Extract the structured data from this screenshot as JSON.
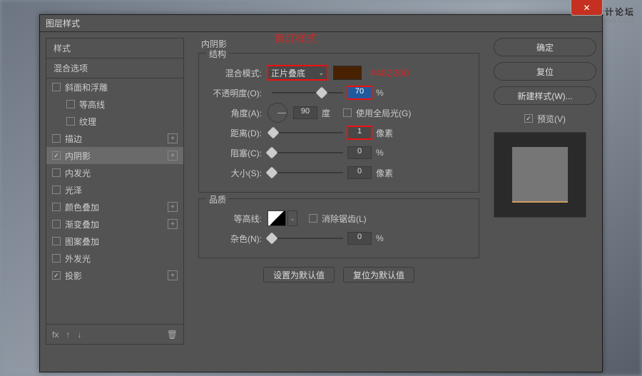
{
  "watermark": {
    "line1": "思缘设计论坛",
    "line2": "WWW.MISSYUAN.COM"
  },
  "close_icon": "✕",
  "dialog_title": "图层样式",
  "anno_title": "黄灯样式",
  "hex_anno": "#482200",
  "left": {
    "header1": "样式",
    "header2": "混合选项",
    "items": [
      {
        "label": "斜面和浮雕",
        "checked": false,
        "plus": false,
        "indent": false
      },
      {
        "label": "等高线",
        "checked": false,
        "plus": false,
        "indent": true
      },
      {
        "label": "纹理",
        "checked": false,
        "plus": false,
        "indent": true
      },
      {
        "label": "描边",
        "checked": false,
        "plus": true,
        "indent": false
      },
      {
        "label": "内阴影",
        "checked": true,
        "plus": true,
        "indent": false,
        "selected": true
      },
      {
        "label": "内发光",
        "checked": false,
        "plus": false,
        "indent": false
      },
      {
        "label": "光泽",
        "checked": false,
        "plus": false,
        "indent": false
      },
      {
        "label": "颜色叠加",
        "checked": false,
        "plus": true,
        "indent": false
      },
      {
        "label": "渐变叠加",
        "checked": false,
        "plus": true,
        "indent": false
      },
      {
        "label": "图案叠加",
        "checked": false,
        "plus": false,
        "indent": false
      },
      {
        "label": "外发光",
        "checked": false,
        "plus": false,
        "indent": false
      },
      {
        "label": "投影",
        "checked": true,
        "plus": true,
        "indent": false
      }
    ],
    "fx": "fx"
  },
  "mid": {
    "section": "内阴影",
    "group1": "结构",
    "blend_label": "混合模式:",
    "blend_value": "正片叠底",
    "opacity_label": "不透明度(O):",
    "opacity_value": "70",
    "percent": "%",
    "angle_label": "角度(A):",
    "angle_value": "90",
    "angle_unit": "度",
    "global_light": "使用全局光(G)",
    "distance_label": "距离(D):",
    "distance_value": "1",
    "px": "像素",
    "choke_label": "阻塞(C):",
    "choke_value": "0",
    "size_label": "大小(S):",
    "size_value": "0",
    "group2": "品质",
    "contour_label": "等高线:",
    "antialias": "消除锯齿(L)",
    "noise_label": "杂色(N):",
    "noise_value": "0",
    "btn_default": "设置为默认值",
    "btn_reset": "复位为默认值"
  },
  "right": {
    "ok": "确定",
    "cancel": "复位",
    "new_style": "新建样式(W)...",
    "preview": "预览(V)"
  }
}
